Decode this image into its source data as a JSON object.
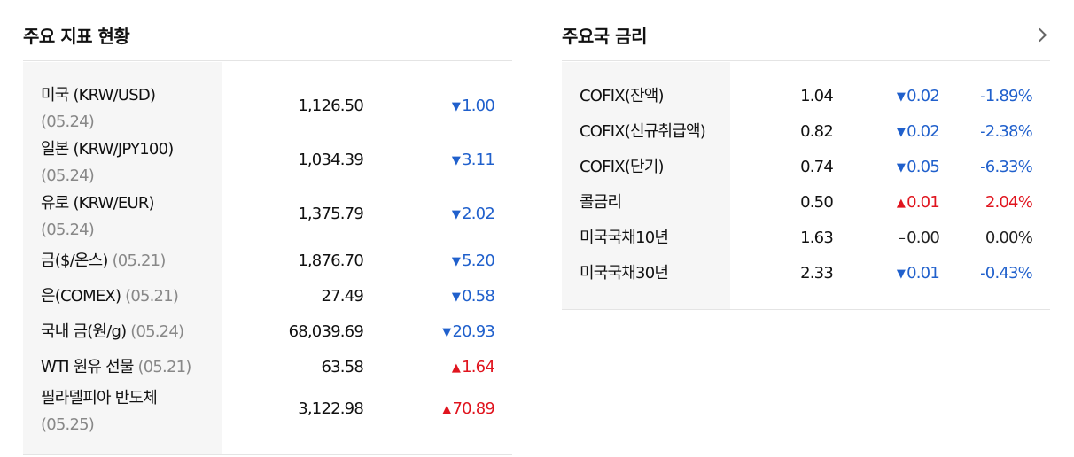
{
  "left": {
    "title": "주요 지표 현황",
    "rows": [
      {
        "name": "미국 (KRW/USD)",
        "date": "(05.24)",
        "value": "1,126.50",
        "dir": "down",
        "arrow": "▼",
        "change": "1.00",
        "twoLine": true
      },
      {
        "name": "일본 (KRW/JPY100)",
        "date": "(05.24)",
        "value": "1,034.39",
        "dir": "down",
        "arrow": "▼",
        "change": "3.11",
        "twoLine": true
      },
      {
        "name": "유로 (KRW/EUR)",
        "date": "(05.24)",
        "value": "1,375.79",
        "dir": "down",
        "arrow": "▼",
        "change": "2.02",
        "twoLine": true
      },
      {
        "name": "금($/온스)",
        "date": "(05.21)",
        "value": "1,876.70",
        "dir": "down",
        "arrow": "▼",
        "change": "5.20",
        "twoLine": false
      },
      {
        "name": "은(COMEX)",
        "date": "(05.21)",
        "value": "27.49",
        "dir": "down",
        "arrow": "▼",
        "change": "0.58",
        "twoLine": false
      },
      {
        "name": "국내 금(원/g)",
        "date": "(05.24)",
        "value": "68,039.69",
        "dir": "down",
        "arrow": "▼",
        "change": "20.93",
        "twoLine": false
      },
      {
        "name": "WTI 원유 선물",
        "date": "(05.21)",
        "value": "63.58",
        "dir": "up",
        "arrow": "▲",
        "change": "1.64",
        "twoLine": false
      },
      {
        "name": "필라델피아 반도체",
        "date": "(05.25)",
        "value": "3,122.98",
        "dir": "up",
        "arrow": "▲",
        "change": "70.89",
        "twoLine": true
      }
    ]
  },
  "right": {
    "title": "주요국 금리",
    "more_icon": "chevron-right-icon",
    "rows": [
      {
        "name": "COFIX(잔액)",
        "value": "1.04",
        "dir": "down",
        "arrow": "▼",
        "change": "0.02",
        "pct": "-1.89%"
      },
      {
        "name": "COFIX(신규취급액)",
        "value": "0.82",
        "dir": "down",
        "arrow": "▼",
        "change": "0.02",
        "pct": "-2.38%"
      },
      {
        "name": "COFIX(단기)",
        "value": "0.74",
        "dir": "down",
        "arrow": "▼",
        "change": "0.05",
        "pct": "-6.33%"
      },
      {
        "name": "콜금리",
        "value": "0.50",
        "dir": "up",
        "arrow": "▲",
        "change": "0.01",
        "pct": "2.04%"
      },
      {
        "name": "미국국채10년",
        "value": "1.63",
        "dir": "flat",
        "arrow": "–",
        "change": "0.00",
        "pct": "0.00%"
      },
      {
        "name": "미국국채30년",
        "value": "2.33",
        "dir": "down",
        "arrow": "▼",
        "change": "0.01",
        "pct": "-0.43%"
      }
    ]
  },
  "colors": {
    "down": "#2060cc",
    "up": "#e0141e",
    "flat": "#222222",
    "date": "#888888"
  }
}
